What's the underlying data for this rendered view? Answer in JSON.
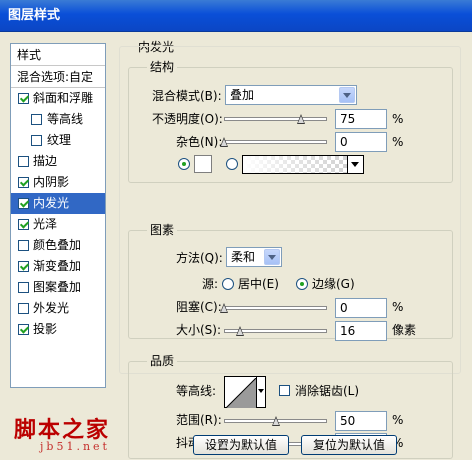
{
  "window": {
    "title": "图层样式"
  },
  "sidebar": {
    "header": "样式",
    "blend": "混合选项:自定",
    "items": [
      {
        "label": "斜面和浮雕",
        "checked": true,
        "sub": false,
        "selected": false
      },
      {
        "label": "等高线",
        "checked": false,
        "sub": true,
        "selected": false
      },
      {
        "label": "纹理",
        "checked": false,
        "sub": true,
        "selected": false
      },
      {
        "label": "描边",
        "checked": false,
        "sub": false,
        "selected": false
      },
      {
        "label": "内阴影",
        "checked": true,
        "sub": false,
        "selected": false
      },
      {
        "label": "内发光",
        "checked": true,
        "sub": false,
        "selected": true
      },
      {
        "label": "光泽",
        "checked": true,
        "sub": false,
        "selected": false
      },
      {
        "label": "颜色叠加",
        "checked": false,
        "sub": false,
        "selected": false
      },
      {
        "label": "渐变叠加",
        "checked": true,
        "sub": false,
        "selected": false
      },
      {
        "label": "图案叠加",
        "checked": false,
        "sub": false,
        "selected": false
      },
      {
        "label": "外发光",
        "checked": false,
        "sub": false,
        "selected": false
      },
      {
        "label": "投影",
        "checked": true,
        "sub": false,
        "selected": false
      }
    ]
  },
  "panel": {
    "title": "内发光",
    "structure": {
      "title": "结构",
      "blend_mode_label": "混合模式(B):",
      "blend_mode_value": "叠加",
      "opacity_label": "不透明度(O):",
      "opacity_value": "75",
      "opacity_level": 75,
      "noise_label": "杂色(N):",
      "noise_value": "0",
      "noise_level": 0,
      "percent": "%"
    },
    "elements": {
      "title": "图素",
      "technique_label": "方法(Q):",
      "technique_value": "柔和",
      "source_label": "源:",
      "center_label": "居中(E)",
      "edge_label": "边缘(G)",
      "choke_label": "阻塞(C):",
      "choke_value": "0",
      "choke_level": 0,
      "size_label": "大小(S):",
      "size_value": "16",
      "size_unit": "像素",
      "percent": "%"
    },
    "quality": {
      "title": "品质",
      "contour_label": "等高线:",
      "antialias_label": "消除锯齿(L)",
      "range_label": "范围(R):",
      "range_value": "50",
      "range_level": 50,
      "jitter_label": "抖动(J):",
      "jitter_value": "0",
      "jitter_level": 0,
      "percent": "%"
    },
    "buttons": {
      "default": "设置为默认值",
      "reset": "复位为默认值"
    }
  },
  "watermark": {
    "line1": "脚本之家",
    "line2": "jb51.net"
  },
  "colors": {
    "titlebar": "#0a4fd8",
    "selection": "#3168c5",
    "check": "#21a121",
    "watermark": "#bb0000"
  }
}
